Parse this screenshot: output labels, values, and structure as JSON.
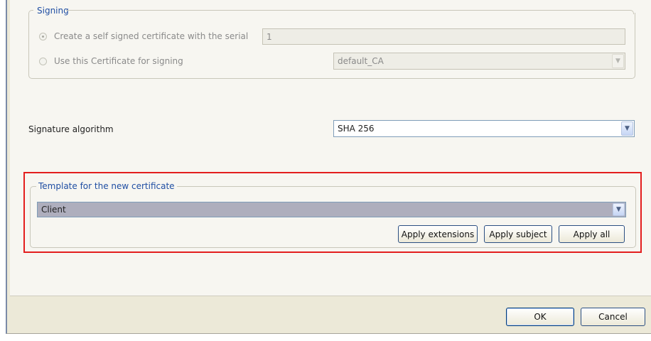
{
  "signing": {
    "legend": "Signing",
    "radio_self_signed": "Create a self signed certificate with the serial",
    "serial_value": "1",
    "radio_use_cert": "Use this Certificate for signing",
    "ca_value": "default_CA"
  },
  "signature": {
    "label": "Signature algorithm",
    "value": "SHA 256"
  },
  "template": {
    "legend": "Template for the new certificate",
    "value": "Client",
    "apply_extensions": "Apply extensions",
    "apply_subject": "Apply subject",
    "apply_all": "Apply all"
  },
  "dialog": {
    "ok": "OK",
    "cancel": "Cancel"
  }
}
